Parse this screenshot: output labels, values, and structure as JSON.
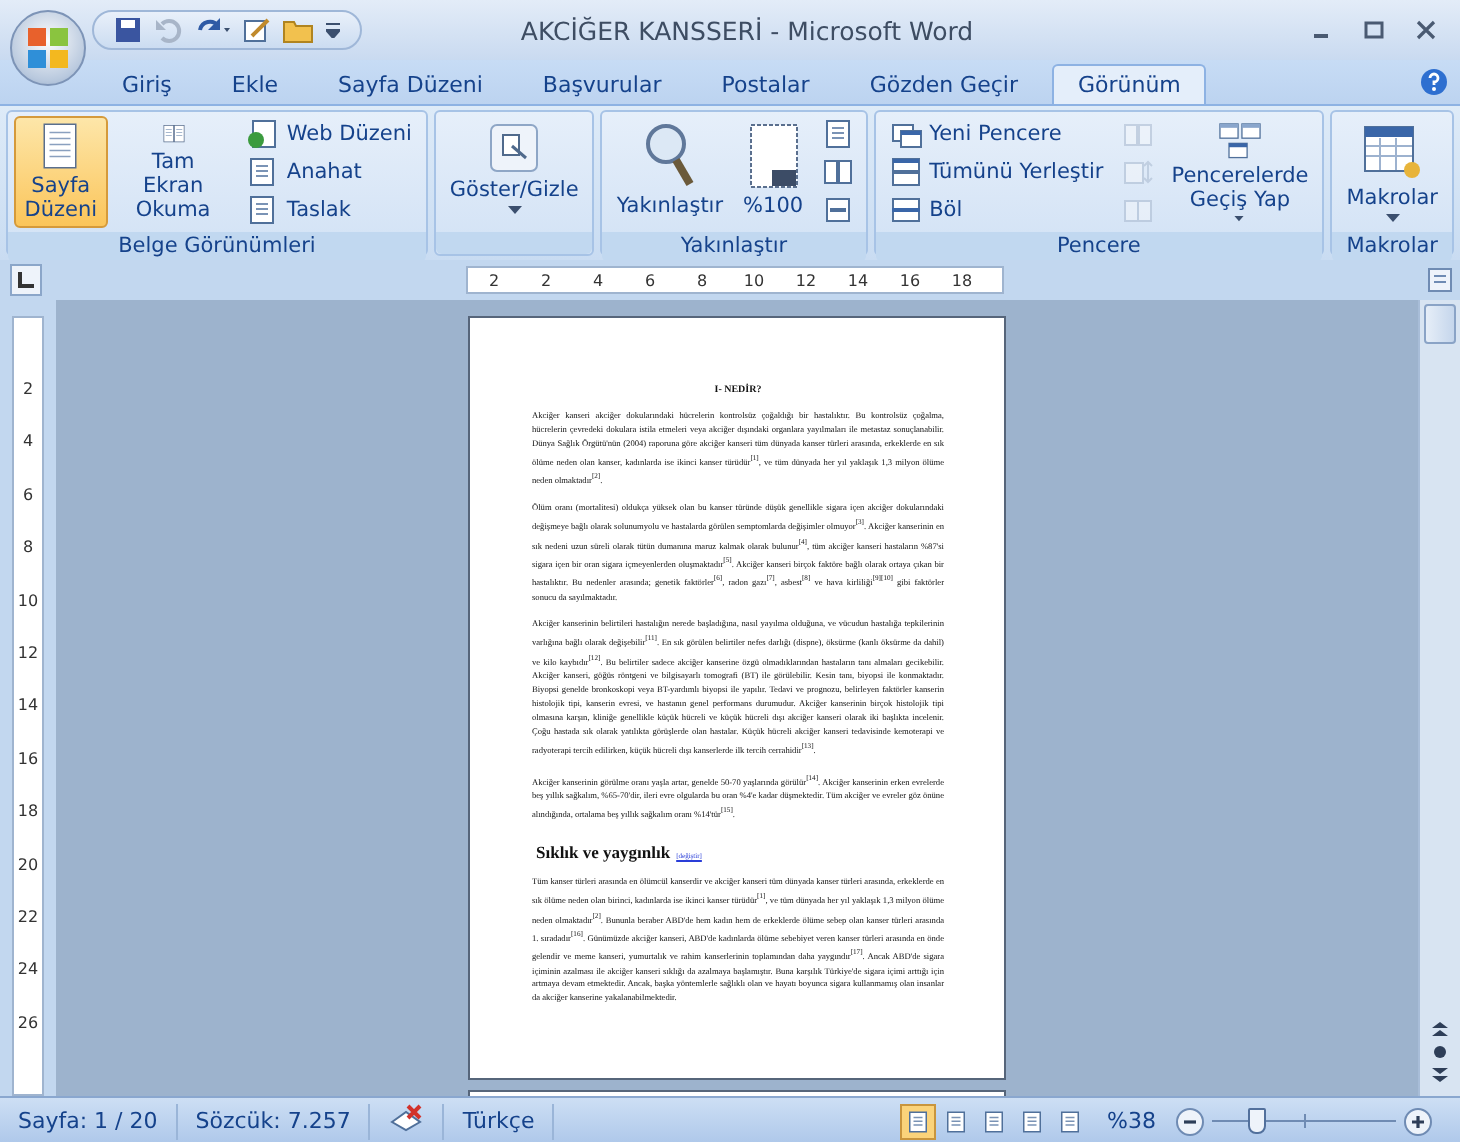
{
  "window": {
    "title": "AKCİĞER KANSSERİ - Microsoft Word"
  },
  "tabs": [
    {
      "label": "Giriş",
      "selected": false
    },
    {
      "label": "Ekle",
      "selected": false
    },
    {
      "label": "Sayfa Düzeni",
      "selected": false
    },
    {
      "label": "Başvurular",
      "selected": false
    },
    {
      "label": "Postalar",
      "selected": false
    },
    {
      "label": "Gözden Geçir",
      "selected": false
    },
    {
      "label": "Görünüm",
      "selected": true
    }
  ],
  "ribbon": {
    "groups": [
      {
        "label": "Belge Görünümleri",
        "items": [
          {
            "kind": "large",
            "label": "Sayfa Düzeni",
            "selected": true
          },
          {
            "kind": "large",
            "label": "Tam Ekran Okuma",
            "selected": false
          },
          {
            "kind": "small",
            "label": "Web Düzeni",
            "selected": false
          },
          {
            "kind": "small",
            "label": "Anahat",
            "selected": false
          },
          {
            "kind": "small",
            "label": "Taslak",
            "selected": false
          }
        ]
      },
      {
        "items": [
          {
            "kind": "menu",
            "label": "Göster/Gizle"
          }
        ]
      },
      {
        "label": "Yakınlaştır",
        "items": [
          {
            "kind": "large",
            "label": "Yakınlaştır"
          },
          {
            "kind": "large",
            "label": "%100"
          },
          {
            "kind": "icon",
            "disabled": false
          },
          {
            "kind": "icon",
            "disabled": false
          },
          {
            "kind": "icon",
            "disabled": false
          }
        ]
      },
      {
        "label": "Pencere",
        "items": [
          {
            "kind": "small",
            "label": "Yeni Pencere"
          },
          {
            "kind": "small",
            "label": "Tümünü Yerleştir"
          },
          {
            "kind": "small",
            "label": "Böl"
          },
          {
            "kind": "icon",
            "disabled": true
          },
          {
            "kind": "icon",
            "disabled": true
          },
          {
            "kind": "icon",
            "disabled": true
          },
          {
            "kind": "menu",
            "label": "Pencerelerde Geçiş Yap"
          }
        ]
      },
      {
        "label": "Makrolar",
        "items": [
          {
            "kind": "menu",
            "label": "Makrolar"
          }
        ]
      }
    ]
  },
  "ruler": {
    "horizontal": [
      "2",
      "2",
      "4",
      "6",
      "8",
      "10",
      "12",
      "14",
      "16",
      "18"
    ],
    "vertical": [
      "2",
      "4",
      "6",
      "8",
      "10",
      "12",
      "14",
      "16",
      "18",
      "20",
      "22",
      "24",
      "26"
    ]
  },
  "document": {
    "title": "I- NEDİR?",
    "blocks": [
      {
        "kind": "paragraph",
        "text": "Akciğer kanseri akciğer dokularındaki hücrelerin kontrolsüz çoğaldığı bir hastalıktır. Bu kontrolsüz çoğalma, hücrelerin çevredeki dokulara istila etmeleri veya akciğer dışındaki organlara yayılmaları ile metastaz sonuçlanabilir. Dünya Sağlık Örgütü'nün (2004) raporuna göre akciğer kanseri tüm dünyada kanser türleri arasında, erkeklerde en sık ölüme neden olan kanser, kadınlarda ise ikinci kanser türüdür$^{[1]}$, ve tüm dünyada her yıl yaklaşık 1,3 milyon ölüme neden olmaktadır$^{[2]}$."
      },
      {
        "kind": "paragraph",
        "text": "Ölüm oranı (mortalitesi) oldukça yüksek olan bu kanser türünde düşük genellikle sigara içen akciğer dokularındaki değişmeye bağlı olarak solunumyolu ve hastalarda görülen semptomlarda değişimler olmuyor$^{[3]}$. Akciğer kanserinin en sık nedeni uzun süreli olarak tütün dumanına maruz kalmak olarak bulunur$^{[4]}$, tüm akciğer kanseri hastaların %87'si sigara içen bir oran sigara içmeyenlerden oluşmaktadır$^{[5]}$. Akciğer kanseri birçok faktöre bağlı olarak ortaya çıkan bir hastalıktır. Bu nedenler arasında; genetik faktörler$^{[6]}$, radon gazı$^{[7]}$, asbest$^{[8]}$ ve hava kirliliği$^{[9][10]}$ gibi faktörler sonucu da sayılmaktadır."
      },
      {
        "kind": "paragraph",
        "text": "Akciğer kanserinin belirtileri hastalığın nerede başladığına, nasıl yayılma olduğuna, ve vücudun hastalığa tepkilerinin varlığına bağlı olarak değişebilir$^{[11]}$. En sık görülen belirtiler nefes darlığı (dispne), öksürme (kanlı öksürme da dahil) ve kilo kaybıdır$^{[12]}$. Bu belirtiler sadece akciğer kanserine özgü olmadıklarından hastaların tanı almaları gecikebilir. Akciğer kanseri, göğüs röntgeni ve bilgisayarlı tomografi (BT) ile görülebilir. Kesin tanı, biyopsi ile konmaktadır. Biyopsi genelde bronkoskopi veya BT-yardımlı biyopsi ile yapılır. Tedavi ve prognozu, belirleyen faktörler kanserin histolojik tipi, kanserin evresi, ve hastanın genel performans durumudur. Akciğer kanserinin birçok histolojik tipi olmasına karşın, kliniğe genellikle küçük hücreli ve küçük hücreli dışı akciğer kanseri olarak iki başlıkta incelenir. Çoğu hastada sık olarak yatılıkta görüşlerde olan hastalar. Küçük hücreli akciğer kanseri tedavisinde kemoterapi ve radyoterapi tercih edilirken, küçük hücreli dışı kanserlerde ilk tercih cerrahidir$^{[13]}$."
      },
      {
        "kind": "paragraph",
        "text": "Akciğer kanserinin görülme oranı yaşla artar, genelde 50-70 yaşlarında görülür$^{[14]}$. Akciğer kanserinin erken evrelerde beş yıllık sağkalım, %65-70'dir, ileri evre olgularda bu oran %4'e kadar düşmektedir. Tüm akciğer ve evreler göz önüne alındığında, ortalama beş yıllık sağkalım oranı %14'tür$^{[15]}$."
      },
      {
        "kind": "heading",
        "text": "Sıklık ve yaygınlık",
        "link": "[değiştir]"
      },
      {
        "kind": "paragraph",
        "text": "Tüm kanser türleri arasında en ölümcül kanserdir ve akciğer kanseri tüm dünyada kanser türleri arasında, erkeklerde en sık ölüme neden olan birinci, kadınlarda ise ikinci kanser türüdür$^{[1]}$, ve tüm dünyada her yıl yaklaşık 1,3 milyon ölüme neden olmaktadır$^{[2]}$. Bununla beraber ABD'de hem kadın hem de erkeklerde ölüme sebep olan kanser türleri arasında 1. sıradadır$^{[16]}$. Günümüzde akciğer kanseri, ABD'de kadınlarda ölüme sebebiyet veren kanser türleri arasında en önde gelendir ve meme kanseri, yumurtalık ve rahim kanserlerinin toplamından daha yaygındır$^{[17]}$. Ancak ABD'de sigara içiminin azalması ile akciğer kanseri sıklığı da azalmaya başlamıştır. Buna karşılık Türkiye'de sigara içimi arttığı için artmaya devam etmektedir. Ancak, başka yöntemlerle sağlıklı olan ve hayatı boyunca sigara kullanmamış olan insanlar da akciğer kanserine yakalanabilmektedir."
      }
    ]
  },
  "status_bar": {
    "page": "Sayfa: 1 / 20",
    "words": "Sözcük: 7.257",
    "language": "Türkçe",
    "views": [
      {
        "selected": true
      },
      {
        "selected": false
      },
      {
        "selected": false
      },
      {
        "selected": false
      },
      {
        "selected": false
      }
    ],
    "zoom": {
      "label": "%38",
      "level": 0.22
    }
  }
}
